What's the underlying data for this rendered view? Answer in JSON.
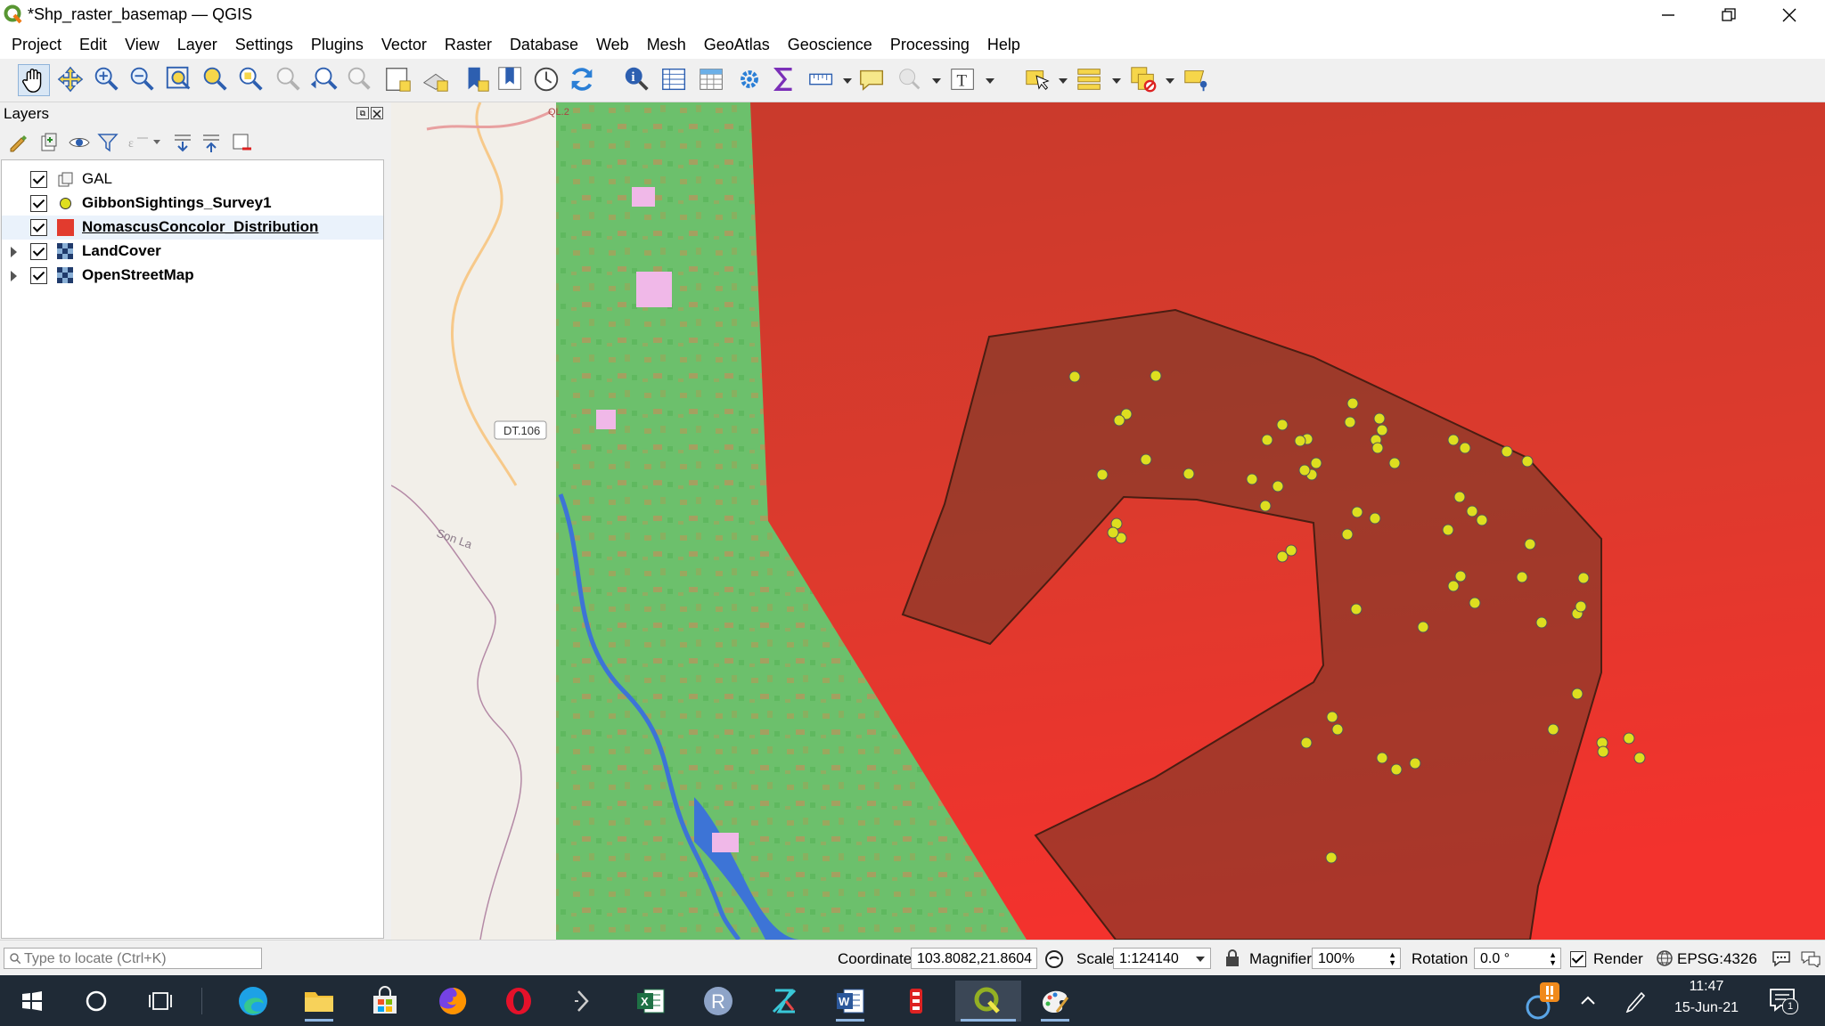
{
  "window": {
    "title": "*Shp_raster_basemap — QGIS",
    "controls": [
      "minimize-icon",
      "restore-icon",
      "close-icon"
    ]
  },
  "menu": [
    "Project",
    "Edit",
    "View",
    "Layer",
    "Settings",
    "Plugins",
    "Vector",
    "Raster",
    "Database",
    "Web",
    "Mesh",
    "GeoAtlas",
    "Geoscience",
    "Processing",
    "Help"
  ],
  "layers_panel": {
    "title": "Layers",
    "layers": [
      {
        "name": "GAL",
        "checked": true,
        "bold": false,
        "underlined": false,
        "expander": false,
        "symbol": "group-icon"
      },
      {
        "name": "GibbonSightings_Survey1",
        "checked": true,
        "bold": true,
        "underlined": false,
        "expander": false,
        "symbol": "point-icon",
        "color": "#dede1f"
      },
      {
        "name": "NomascusConcolor_Distribution",
        "checked": true,
        "bold": true,
        "underlined": true,
        "expander": false,
        "symbol": "polygon-icon",
        "color": "#e23b2e"
      },
      {
        "name": "LandCover",
        "checked": true,
        "bold": true,
        "underlined": false,
        "expander": true,
        "symbol": "raster-icon"
      },
      {
        "name": "OpenStreetMap",
        "checked": true,
        "bold": true,
        "underlined": false,
        "expander": true,
        "symbol": "raster-icon"
      }
    ]
  },
  "map": {
    "labels": {
      "road": "DT.106",
      "region": "Son La",
      "top": "QL.2"
    },
    "colors": {
      "distribution": "#d93a2e",
      "survey_polygon": "#8a3a22",
      "sightings": "#dede1f",
      "landcover": "#6cc06c",
      "water": "#3d74d6",
      "basemap": "#f2efe9"
    }
  },
  "statusbar": {
    "locate_placeholder": "Type to locate (Ctrl+K)",
    "coordinate_label": "Coordinate",
    "coordinate_value": "103.8082,21.8604",
    "scale_label": "Scale",
    "scale_value": "1:124140",
    "magnifier_label": "Magnifier",
    "magnifier_value": "100%",
    "rotation_label": "Rotation",
    "rotation_value": "0.0 °",
    "render_label": "Render",
    "crs": "EPSG:4326"
  },
  "taskbar": {
    "time": "11:47",
    "date": "15-Jun-21",
    "notification_count": "1",
    "apps": [
      "windows-start-icon",
      "cortana-icon",
      "task-view-icon",
      "edge-icon",
      "file-explorer-icon",
      "store-icon",
      "firefox-icon",
      "opera-icon",
      "terminal-icon",
      "excel-icon",
      "r-icon",
      "rstudio-icon",
      "word-icon",
      "app-icon",
      "qgis-icon",
      "paint-icon"
    ]
  }
}
